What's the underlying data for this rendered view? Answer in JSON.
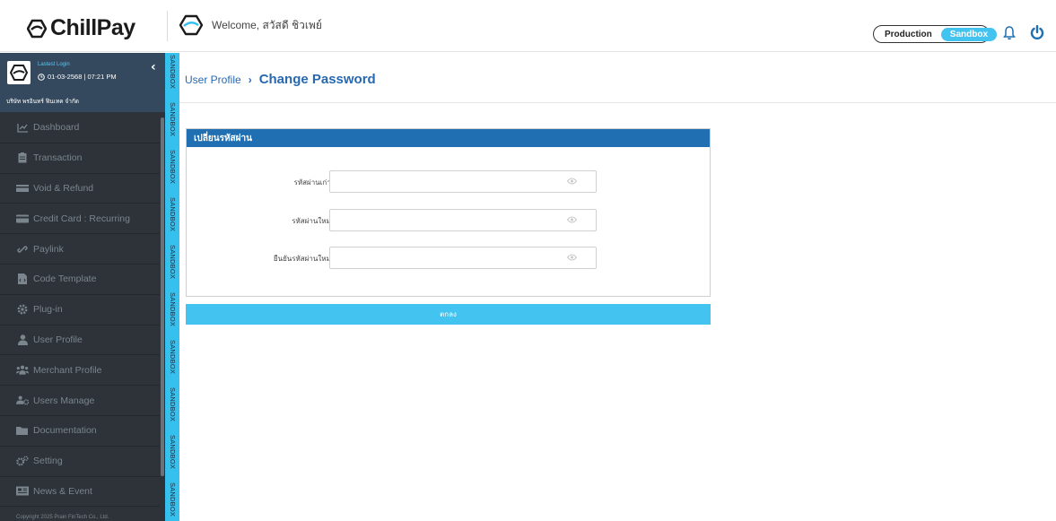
{
  "brand": {
    "name": "ChillPay"
  },
  "header": {
    "welcome": "Welcome, สวัสดี ชิวเพย์",
    "env_production": "Production",
    "env_sandbox": "Sandbox"
  },
  "sidebar": {
    "lastest_login_label": "Lastest Login",
    "login_datetime": "01-03-2568 | 07:21 PM",
    "company": "บริษัท พรอินทร์ ฟินเทค จำกัด",
    "items": [
      {
        "label": "Dashboard",
        "icon": "chart-line-icon"
      },
      {
        "label": "Transaction",
        "icon": "clipboard-icon"
      },
      {
        "label": "Void & Refund",
        "icon": "money-icon"
      },
      {
        "label": "Credit Card : Recurring",
        "icon": "credit-card-icon"
      },
      {
        "label": "Paylink",
        "icon": "link-icon"
      },
      {
        "label": "Code Template",
        "icon": "file-code-icon"
      },
      {
        "label": "Plug-in",
        "icon": "gear-icon"
      },
      {
        "label": "User Profile",
        "icon": "user-icon"
      },
      {
        "label": "Merchant Profile",
        "icon": "users-icon"
      },
      {
        "label": "Users Manage",
        "icon": "users-cog-icon"
      },
      {
        "label": "Documentation",
        "icon": "folder-icon"
      },
      {
        "label": "Setting",
        "icon": "cogs-icon"
      },
      {
        "label": "News & Event",
        "icon": "newspaper-icon"
      }
    ],
    "copyright": "Copyright 2025 Prain FinTech Co., Ltd."
  },
  "sandbox_strip": {
    "label": "SANDBOX"
  },
  "breadcrumb": {
    "parent": "User Profile",
    "separator": "›",
    "current": "Change Password"
  },
  "form": {
    "title": "เปลี่ยนรหัสผ่าน",
    "fields": [
      {
        "label": "รหัสผ่านเก่า:",
        "value": ""
      },
      {
        "label": "รหัสผ่านใหม่:",
        "value": ""
      },
      {
        "label": "ยืนยันรหัสผ่านใหม่:",
        "value": ""
      }
    ],
    "submit_label": "ตกลง"
  },
  "colors": {
    "primary_blue": "#1f6fb2",
    "accent_cyan": "#43c3ef",
    "sidebar_bg": "#2d3338",
    "userbox_bg": "#35495e"
  }
}
